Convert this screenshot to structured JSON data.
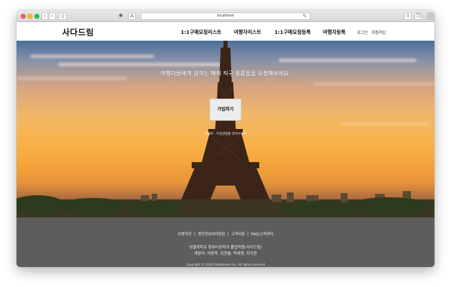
{
  "browser": {
    "url": "localhost",
    "reload_icon": "reload-icon",
    "back_icon": "chevron-left-icon",
    "forward_icon": "chevron-right-icon",
    "sidebar_icon": "sidebar-icon",
    "shield_icon": "shield-icon",
    "reader_label": "A",
    "share_icon": "share-icon",
    "tabs_icon": "tabs-icon"
  },
  "header": {
    "logo": "사다드림",
    "menu": [
      "1:1구매요청리스트",
      "여행자리스트",
      "1:1구매요청등록",
      "여행자등록"
    ],
    "login": "로그인",
    "signup": "회원가입"
  },
  "hero": {
    "headline": "여행자들에게 원하는 해외 직구 용품들을 요청해보세요.",
    "join_button": "가입하기",
    "sub_text": "여행자 · 이용방법을 알아보세요"
  },
  "footer": {
    "links": [
      "이용약관",
      "개인정보처리방침",
      "고객사항",
      "FAQ/고객센터"
    ],
    "line1": "성결대학교 컴퓨터공학과 졸업작품(사다드림)",
    "line2": "개발자: 이동욱, 김한솔, 박세영, 이지윤",
    "copyright": "Copyright © 2020 Sadadream Inc. All rights reserved"
  },
  "colors": {
    "footer_bg": "#5d5d5d",
    "header_bg": "#ffffff",
    "sunset_orange": "#f9b24a"
  }
}
